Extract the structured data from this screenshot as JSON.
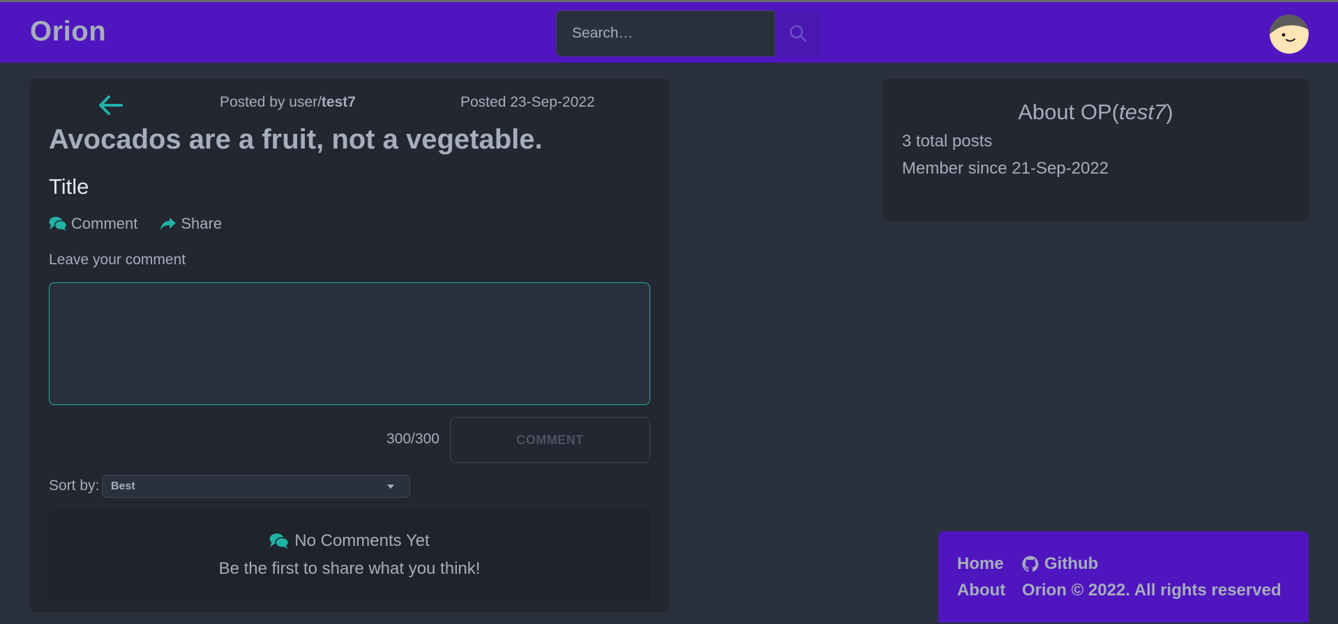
{
  "app": {
    "brand": "Orion"
  },
  "search": {
    "placeholder": "Search…"
  },
  "post": {
    "posted_by_prefix": "Posted by user/",
    "author": "test7",
    "posted_date": "Posted 23-Sep-2022",
    "title": "Avocados are a fruit, not a vegetable.",
    "body": "Title",
    "actions": {
      "comment_label": "Comment",
      "share_label": "Share"
    }
  },
  "comment_form": {
    "label": "Leave your comment",
    "value": "",
    "char_count": "300/300",
    "submit_label": "COMMENT"
  },
  "sort": {
    "label": "Sort by:",
    "selected": "Best"
  },
  "no_comments": {
    "title": "No Comments Yet",
    "subtitle": "Be the first to share what you think!"
  },
  "about_op": {
    "title_prefix": "About OP(",
    "username": "test7",
    "title_suffix": ")",
    "total_posts": "3 total posts",
    "member_since": "Member since 21-Sep-2022"
  },
  "footer": {
    "home": "Home",
    "github": "Github",
    "about": "About",
    "copyright": "Orion © 2022. All rights reserved"
  },
  "colors": {
    "navbar": "#4f16bf",
    "background": "#2a303c",
    "card": "#232731",
    "accent": "#1fb2a6",
    "text": "#a6adbb"
  },
  "icons": [
    "search-icon",
    "avatar",
    "arrow-left-icon",
    "comments-icon",
    "share-icon",
    "github-icon",
    "chevron-down-icon"
  ]
}
